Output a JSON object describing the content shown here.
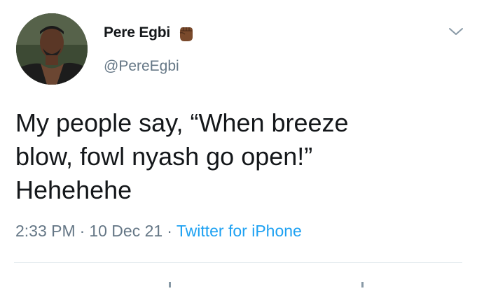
{
  "author": {
    "display_name": "Pere Egbi",
    "handle": "@PereEgbi",
    "name_emoji_icon": "raised-fist-icon",
    "avatar_icon": "profile-photo"
  },
  "tweet": {
    "lines": [
      "My people say, “When breeze",
      "blow, fowl nyash go open!”",
      "Hehehehe"
    ]
  },
  "meta": {
    "time": "2:33 PM",
    "separator": "·",
    "date": "10 Dec 21",
    "source": "Twitter for iPhone"
  },
  "colors": {
    "text_primary": "#14171a",
    "text_secondary": "#657786",
    "link": "#1da1f2",
    "divider": "#e1e8ed"
  }
}
